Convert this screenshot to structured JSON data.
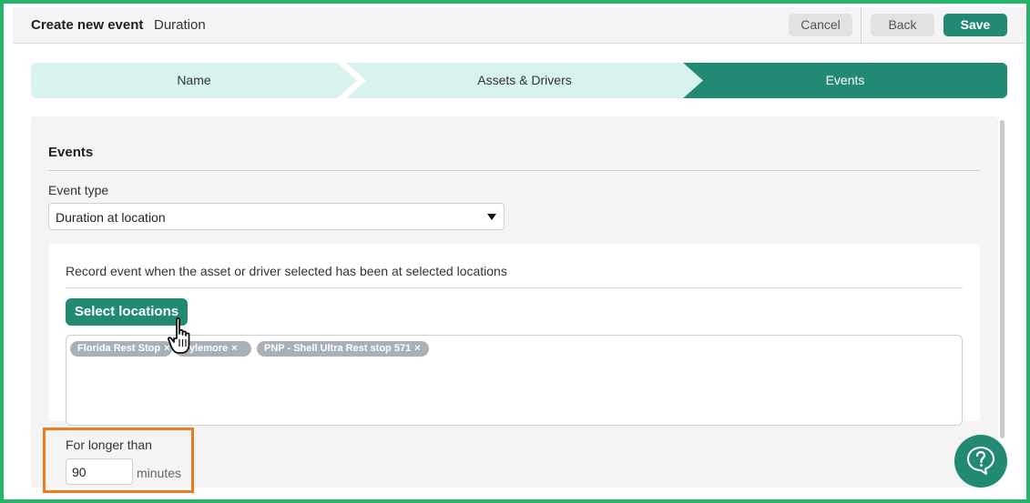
{
  "header": {
    "title": "Create new event",
    "subtitle": "Duration",
    "cancel_label": "Cancel",
    "back_label": "Back",
    "save_label": "Save"
  },
  "stepper": {
    "steps": [
      {
        "label": "Name",
        "state": "done"
      },
      {
        "label": "Assets & Drivers",
        "state": "done"
      },
      {
        "label": "Events",
        "state": "active"
      }
    ]
  },
  "events": {
    "section_title": "Events",
    "event_type_label": "Event type",
    "event_type_value": "Duration at location",
    "description": "Record event when the asset or driver selected has been at selected locations",
    "select_locations_label": "Select locations",
    "selected_locations": [
      {
        "label": "Florida Rest Stop",
        "remove": "×"
      },
      {
        "label": "Kylemore",
        "remove": "×"
      },
      {
        "label": "PNP - Shell Ultra Rest stop 571",
        "remove": "×"
      }
    ],
    "longer_than_label": "For longer than",
    "longer_than_value": "90",
    "longer_than_unit": "minutes"
  },
  "help": {
    "icon": "help-question-chat-icon"
  },
  "colors": {
    "brand_green": "#228a73",
    "step_light": "#d8f3ef",
    "frame_border": "#26b36a",
    "highlight": "#f07a1a",
    "tag_gray": "#a9b1b8"
  }
}
